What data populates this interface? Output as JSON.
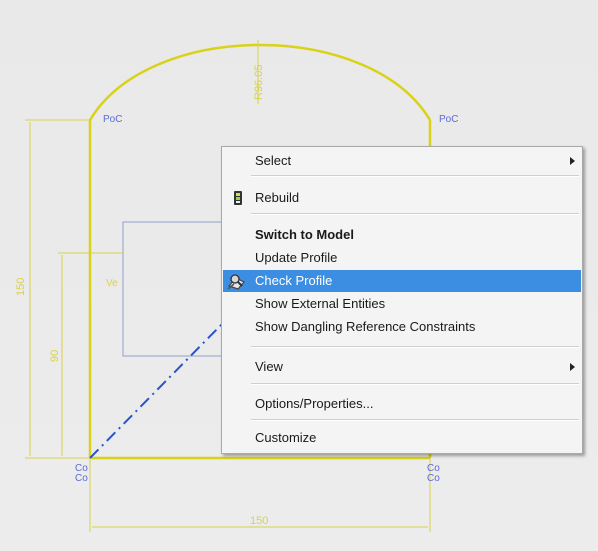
{
  "sketch": {
    "dimensions": {
      "radius": "R96.05",
      "height_outer": "150",
      "height_inner": "90",
      "width_bottom": "150"
    },
    "labels": {
      "poc_left": "PoC",
      "poc_right": "PoC",
      "ve": "Ve",
      "co_left_1": "Co",
      "co_left_2": "Co",
      "co_right_1": "Co",
      "co_right_2": "Co"
    }
  },
  "context_menu": {
    "items": [
      {
        "label": "Select"
      },
      {
        "label": "Rebuild"
      },
      {
        "label": "Switch to Model"
      },
      {
        "label": "Update Profile"
      },
      {
        "label": "Check Profile"
      },
      {
        "label": "Show External Entities"
      },
      {
        "label": "Show Dangling Reference Constraints"
      },
      {
        "label": "View"
      },
      {
        "label": "Options/Properties..."
      },
      {
        "label": "Customize"
      }
    ]
  },
  "colors": {
    "profile_yellow": "#d9d219",
    "dimension_yellow": "#d9d24a",
    "construction_blue": "#2a52c9",
    "highlight": "#3b8ee2"
  }
}
